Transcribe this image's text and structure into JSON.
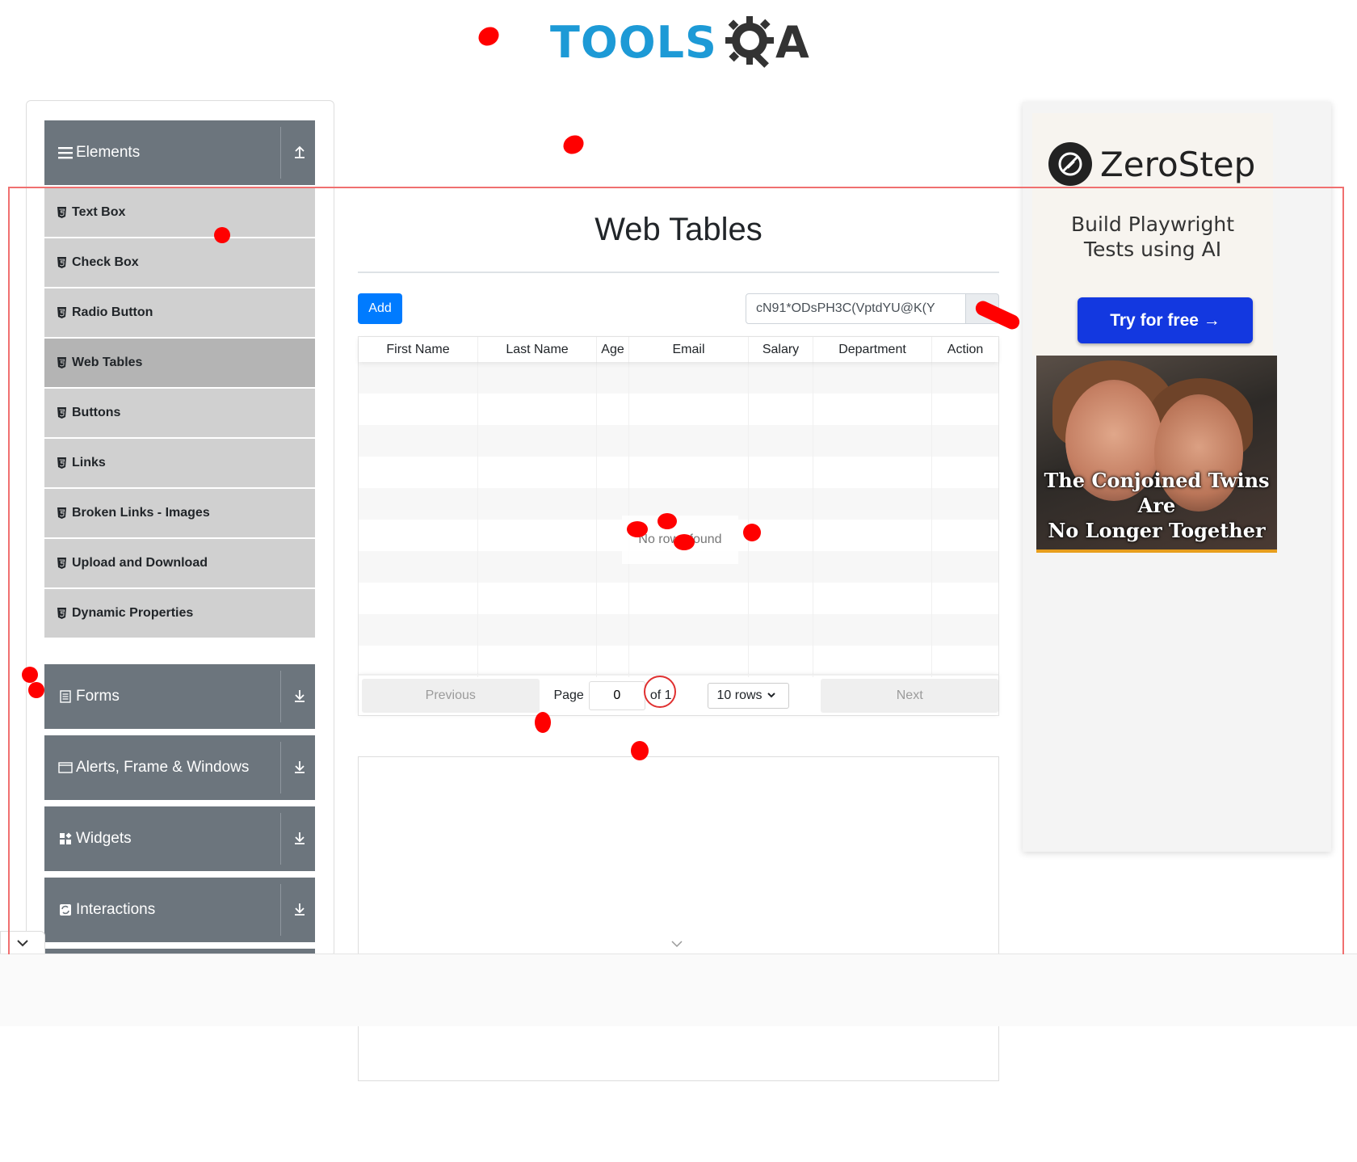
{
  "header": {
    "logo_text_left": "TOOLS",
    "logo_text_right": "A"
  },
  "sidebar": {
    "groups": [
      {
        "label": "Elements",
        "icon": "hamburger-icon",
        "expanded": true
      },
      {
        "label": "Forms",
        "icon": "document-icon",
        "expanded": false
      },
      {
        "label": "Alerts, Frame & Windows",
        "icon": "window-icon",
        "expanded": false
      },
      {
        "label": "Widgets",
        "icon": "widgets-icon",
        "expanded": false
      },
      {
        "label": "Interactions",
        "icon": "interactions-icon",
        "expanded": false
      }
    ],
    "items": [
      {
        "label": "Text Box",
        "active": false
      },
      {
        "label": "Check Box",
        "active": false
      },
      {
        "label": "Radio Button",
        "active": false
      },
      {
        "label": "Web Tables",
        "active": true
      },
      {
        "label": "Buttons",
        "active": false
      },
      {
        "label": "Links",
        "active": false
      },
      {
        "label": "Broken Links - Images",
        "active": false
      },
      {
        "label": "Upload and Download",
        "active": false
      },
      {
        "label": "Dynamic Properties",
        "active": false
      }
    ]
  },
  "main": {
    "title": "Web Tables",
    "add_label": "Add",
    "search_value": "cN91*ODsPH3C(VptdYU@K(Y",
    "columns": [
      "First Name",
      "Last Name",
      "Age",
      "Email",
      "Salary",
      "Department",
      "Action"
    ],
    "empty_text": "No rows found",
    "pagination": {
      "previous_label": "Previous",
      "page_label": "Page",
      "page_value": "0",
      "of_label": "of 1",
      "rows_option": "10 rows",
      "next_label": "Next"
    }
  },
  "ad": {
    "brand": "ZeroStep",
    "headline_line1": "Build Playwright",
    "headline_line2": "Tests using AI",
    "cta": "Try for free →",
    "caption_line1": "The Conjoined Twins Are",
    "caption_line2": "No Longer Together",
    "accent_color": "#1338e0"
  },
  "colors": {
    "sidebar_group_bg": "#6c757d",
    "sidebar_item_bg": "#d0d0d0",
    "primary": "#007bff",
    "logo_blue": "#1d9ad6"
  }
}
